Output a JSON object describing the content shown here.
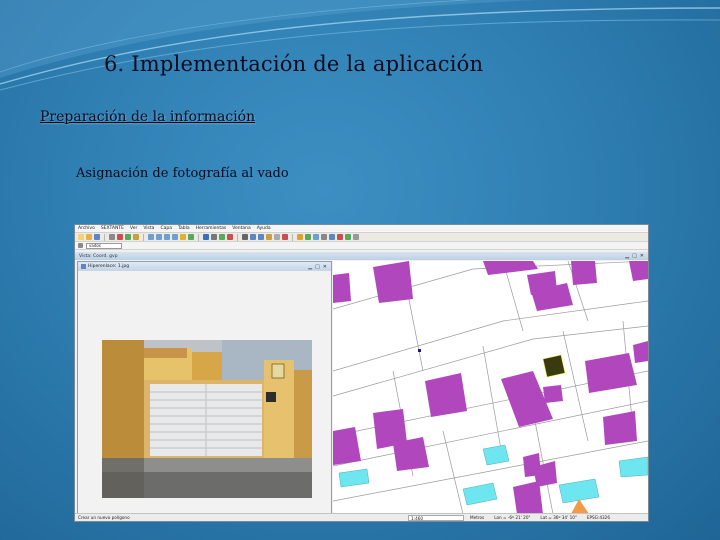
{
  "slide": {
    "title": "6. Implementación de la aplicación",
    "section": "Preparación de la información",
    "subsection": "Asignación de fotografía al vado"
  },
  "app": {
    "menu": [
      "Archivo",
      "SEXTANTE",
      "Ver",
      "Vista",
      "Capa",
      "Tabla",
      "Herramientas",
      "Ventana",
      "Ayuda"
    ],
    "layer_select_value": "vados",
    "view_title": "Vista: Coord. gvp",
    "photo_window_title": "Hiperenlace: 1.jpg",
    "status": {
      "message": "Crear un nuevo polígono",
      "scale_value": "1:460",
      "units": "Metros",
      "lon": "Lon = -6º 21' 20\"",
      "lat": "Lat = 36º 34' 10\"",
      "crs": "EPSG:4326"
    }
  },
  "colors": {
    "background": "#2f7fb3",
    "building_fill": "#b147bd",
    "pool_fill": "#6ee6f0",
    "selected_feature": "#3a3a10",
    "parcel_line": "#9a9a9a"
  },
  "icons": [
    "window-minimize-icon",
    "window-maximize-icon",
    "close-icon"
  ]
}
